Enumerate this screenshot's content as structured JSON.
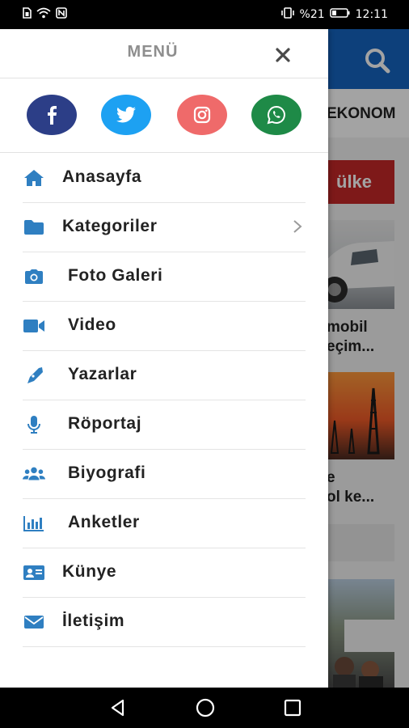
{
  "status_bar": {
    "left_icons": [
      "sim-icon",
      "wifi-icon",
      "nfc-icon"
    ],
    "right_icons": [
      "vibrate-icon"
    ],
    "battery_text": "%21",
    "time": "12:11"
  },
  "background": {
    "tab_label": "EKONOM",
    "badge_text": "ülke",
    "headline_1_line_1": "mobil",
    "headline_1_line_2": "eçim...",
    "headline_2_line_1": "e",
    "headline_2_line_2": "ol ke..."
  },
  "drawer": {
    "title": "MENÜ",
    "social": [
      {
        "name": "facebook",
        "color": "#2c3e87"
      },
      {
        "name": "twitter",
        "color": "#1da1f2"
      },
      {
        "name": "instagram",
        "color": "#ef6a6a"
      },
      {
        "name": "whatsapp",
        "color": "#1e8a47"
      }
    ],
    "items": [
      {
        "label": "Anasayfa",
        "icon": "home-icon"
      },
      {
        "label": "Kategoriler",
        "icon": "folder-icon"
      },
      {
        "label": "Foto Galeri",
        "icon": "camera-icon"
      },
      {
        "label": "Video",
        "icon": "video-camera-icon"
      },
      {
        "label": "Yazarlar",
        "icon": "pen-icon"
      },
      {
        "label": "Röportaj",
        "icon": "microphone-icon"
      },
      {
        "label": "Biyografi",
        "icon": "users-icon"
      },
      {
        "label": "Anketler",
        "icon": "bar-chart-icon"
      },
      {
        "label": "Künye",
        "icon": "id-card-icon"
      },
      {
        "label": "İletişim",
        "icon": "envelope-icon"
      }
    ]
  },
  "colors": {
    "accent": "#2f7fc1",
    "header_blue": "#1565c0",
    "badge_red": "#c62828"
  }
}
